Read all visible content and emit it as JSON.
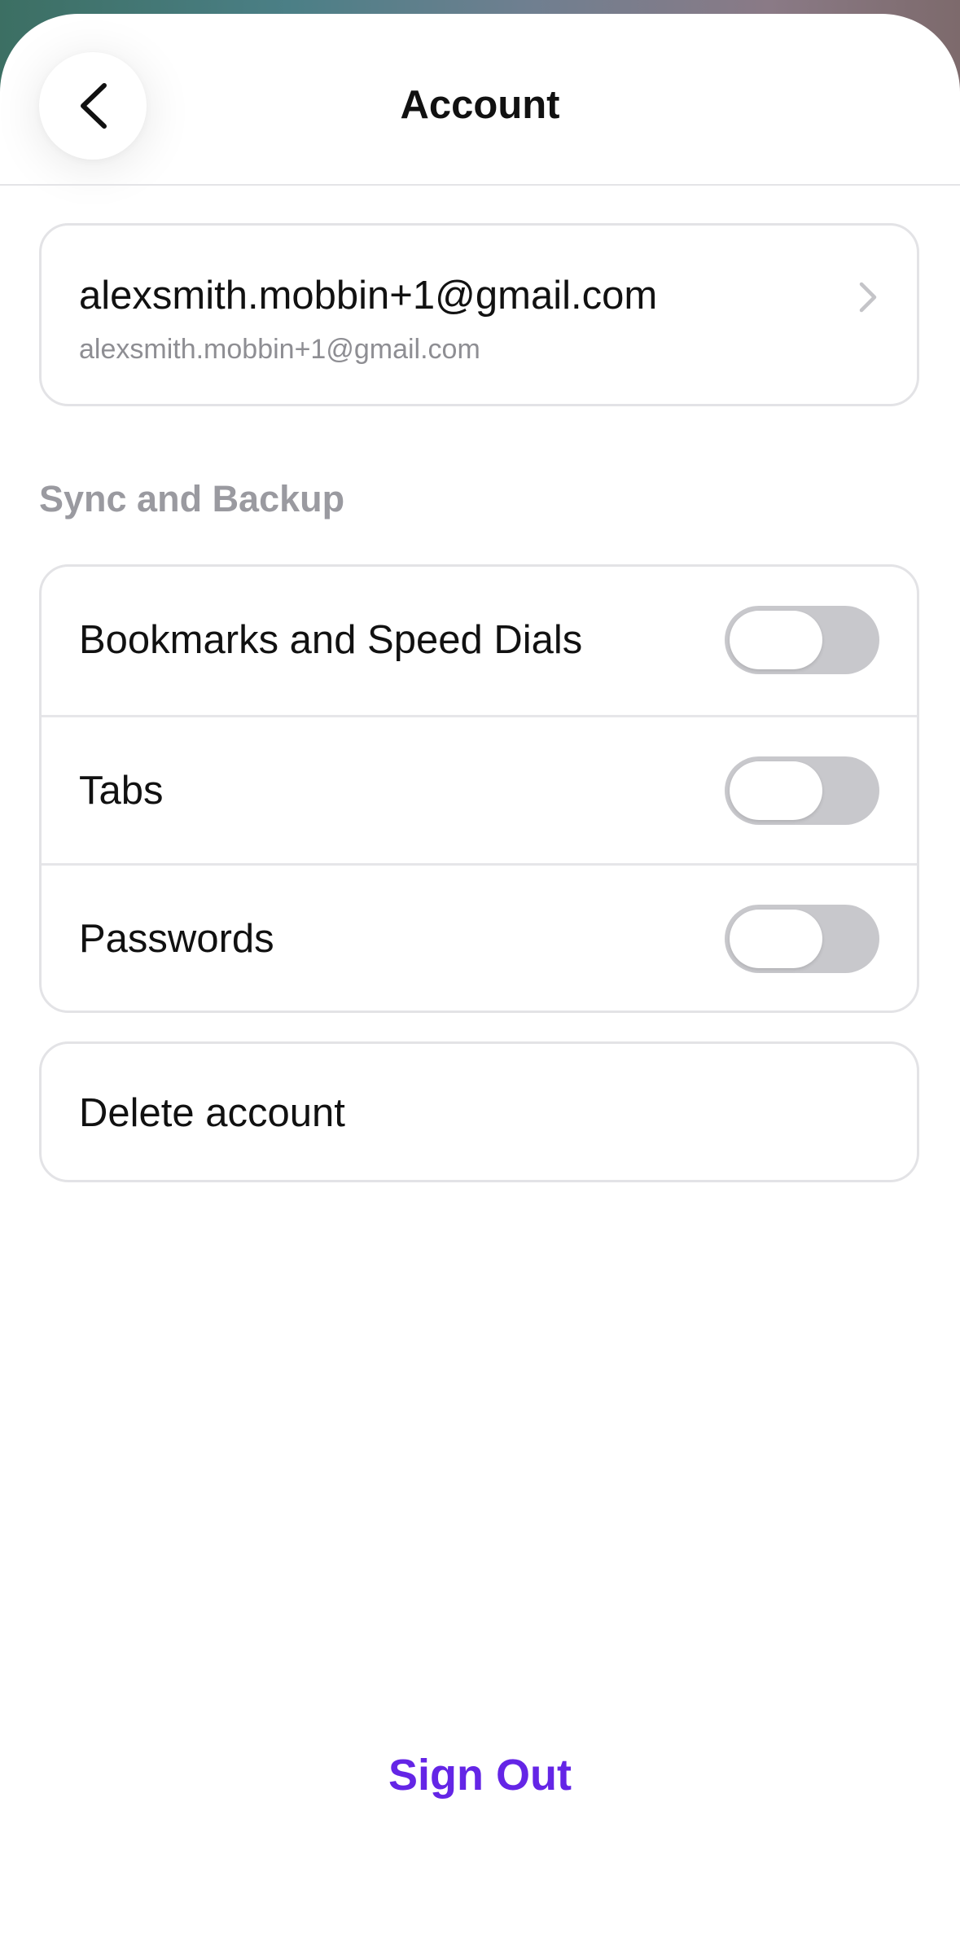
{
  "header": {
    "title": "Account",
    "back_icon": "chevron-left-icon"
  },
  "account": {
    "email": "alexsmith.mobbin+1@gmail.com",
    "subtitle": "alexsmith.mobbin+1@gmail.com",
    "chevron_icon": "chevron-right-icon"
  },
  "sync": {
    "section_label": "Sync and Backup",
    "items": [
      {
        "label": "Bookmarks and Speed Dials",
        "enabled": false
      },
      {
        "label": "Tabs",
        "enabled": false
      },
      {
        "label": "Passwords",
        "enabled": false
      }
    ]
  },
  "delete": {
    "label": "Delete account"
  },
  "sign_out": {
    "label": "Sign Out"
  },
  "colors": {
    "accent": "#6425e6",
    "toggle_off": "#c8c8cc",
    "section_label": "#9a9aa0",
    "divider": "#e3e3e6"
  }
}
